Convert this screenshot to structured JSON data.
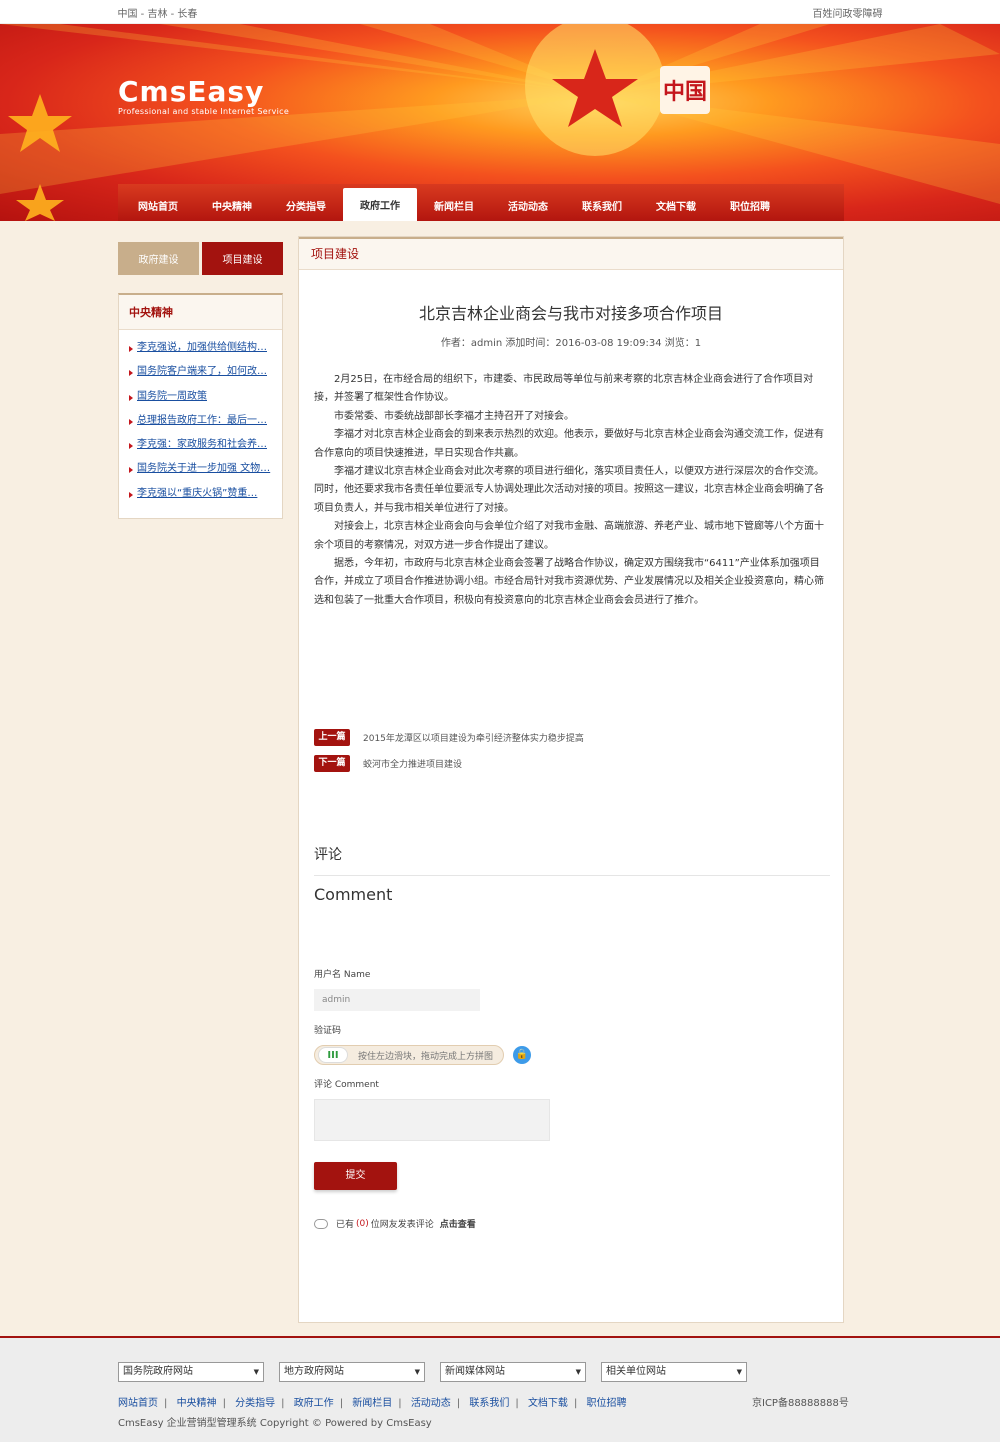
{
  "topbar": {
    "location": "中国 - 吉林 - 长春",
    "right_link": "百姓问政零障碍"
  },
  "logo": {
    "brand": "CmsEasy",
    "tagline": "Professional and stable Internet Service",
    "seal": "中国"
  },
  "nav": [
    "网站首页",
    "中央精神",
    "分类指导",
    "政府工作",
    "新闻栏目",
    "活动动态",
    "联系我们",
    "文档下载",
    "职位招聘"
  ],
  "nav_active": 3,
  "subtabs": [
    "政府建设",
    "项目建设"
  ],
  "sidebar": {
    "title": "中央精神",
    "items": [
      "李克强说，加强供给侧结构…",
      "国务院客户端来了，如何改…",
      "国务院一周政策",
      "总理报告政府工作：最后一…",
      "李克强：家政服务和社会养…",
      "国务院关于进一步加强 文物…",
      "李克强以“重庆火锅”赞重…"
    ]
  },
  "main": {
    "header": "项目建设",
    "title": "北京吉林企业商会与我市对接多项合作项目",
    "meta": "作者：admin   添加时间：2016-03-08 19:09:34   浏览：1",
    "paragraphs": [
      "2月25日，在市经合局的组织下，市建委、市民政局等单位与前来考察的北京吉林企业商会进行了合作项目对接，并签署了框架性合作协议。",
      "市委常委、市委统战部部长李福才主持召开了对接会。",
      "李福才对北京吉林企业商会的到来表示热烈的欢迎。他表示，要做好与北京吉林企业商会沟通交流工作，促进有合作意向的项目快速推进，早日实现合作共赢。",
      "李福才建议北京吉林企业商会对此次考察的项目进行细化，落实项目责任人，以便双方进行深层次的合作交流。同时，他还要求我市各责任单位要派专人协调处理此次活动对接的项目。按照这一建议，北京吉林企业商会明确了各项目负责人，并与我市相关单位进行了对接。",
      "对接会上，北京吉林企业商会向与会单位介绍了对我市金融、高端旅游、养老产业、城市地下管廊等八个方面十余个项目的考察情况，对双方进一步合作提出了建议。",
      "据悉，今年初，市政府与北京吉林企业商会签署了战略合作协议，确定双方围绕我市“6411”产业体系加强项目合作，并成立了项目合作推进协调小组。市经合局针对我市资源优势、产业发展情况以及相关企业投资意向，精心筛选和包装了一批重大合作项目，积极向有投资意向的北京吉林企业商会会员进行了推介。"
    ],
    "prev_label": "上一篇",
    "prev_text": "2015年龙潭区以项目建设为牵引经济整体实力稳步提高",
    "next_label": "下一篇",
    "next_text": "蛟河市全力推进项目建设"
  },
  "comment": {
    "title_cn": "评论",
    "title_en": "Comment",
    "user_label": "用户名 Name",
    "user_value": "admin",
    "captcha_label": "验证码",
    "slider_knob": "III",
    "slider_text": "按住左边滑块，拖动完成上方拼图",
    "comment_label": "评论 Comment",
    "submit": "提交",
    "count_prefix": "已有",
    "count": "(0)",
    "count_suffix": "位网友发表评论",
    "view": "点击查看"
  },
  "footer": {
    "selects": [
      "国务院政府网站",
      "地方政府网站",
      "新闻媒体网站",
      "相关单位网站"
    ],
    "links": [
      "网站首页",
      "中央精神",
      "分类指导",
      "政府工作",
      "新闻栏目",
      "活动动态",
      "联系我们",
      "文档下载",
      "职位招聘"
    ],
    "icp": "京ICP备88888888号",
    "copyright": "CmsEasy 企业营销型管理系统  Copyright ©   Powered by CmsEasy"
  },
  "colors": {
    "brand_red": "#a3130f",
    "tan": "#c8ae8b",
    "link": "#1a4fa0"
  }
}
